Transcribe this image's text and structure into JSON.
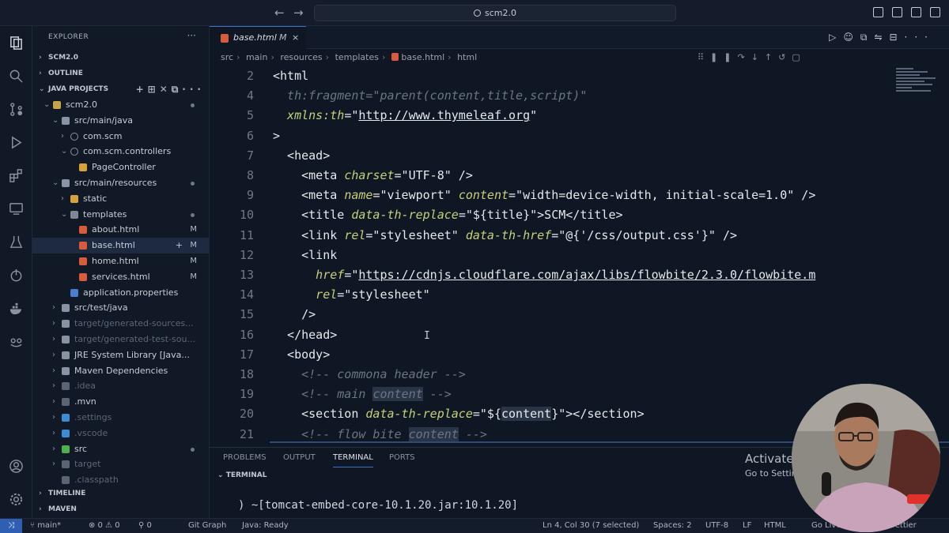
{
  "titlebar": {
    "search": "scm2.0",
    "back_icon": "arrow-left-icon",
    "forward_icon": "arrow-right-icon"
  },
  "explorer": {
    "title": "EXPLORER",
    "sections": {
      "scm": "SCM2.0",
      "outline": "OUTLINE",
      "java_projects": "JAVA PROJECTS",
      "timeline": "TIMELINE",
      "maven": "MAVEN"
    },
    "tree": [
      {
        "label": "scm2.0",
        "badge": "",
        "dot": true
      },
      {
        "label": "src/main/java",
        "badge": "",
        "dot": false
      },
      {
        "label": "com.scm",
        "badge": "",
        "dot": false
      },
      {
        "label": "com.scm.controllers",
        "badge": "",
        "dot": false
      },
      {
        "label": "PageController",
        "badge": "",
        "dot": false
      },
      {
        "label": "src/main/resources",
        "badge": "",
        "dot": true
      },
      {
        "label": "static",
        "badge": "",
        "dot": false
      },
      {
        "label": "templates",
        "badge": "",
        "dot": true
      },
      {
        "label": "about.html",
        "badge": "M",
        "dot": false
      },
      {
        "label": "base.html",
        "badge": "M",
        "dot": false
      },
      {
        "label": "home.html",
        "badge": "M",
        "dot": false
      },
      {
        "label": "services.html",
        "badge": "M",
        "dot": false
      },
      {
        "label": "application.properties",
        "badge": "",
        "dot": false
      },
      {
        "label": "src/test/java",
        "badge": "",
        "dot": false
      },
      {
        "label": "target/generated-sources...",
        "badge": "",
        "dot": false
      },
      {
        "label": "target/generated-test-sou...",
        "badge": "",
        "dot": false
      },
      {
        "label": "JRE System Library [Java...",
        "badge": "",
        "dot": false
      },
      {
        "label": "Maven Dependencies",
        "badge": "",
        "dot": false
      },
      {
        "label": ".idea",
        "badge": "",
        "dot": false
      },
      {
        "label": ".mvn",
        "badge": "",
        "dot": false
      },
      {
        "label": ".settings",
        "badge": "",
        "dot": false
      },
      {
        "label": ".vscode",
        "badge": "",
        "dot": false
      },
      {
        "label": "src",
        "badge": "",
        "dot": true
      },
      {
        "label": "target",
        "badge": "",
        "dot": false
      },
      {
        "label": ".classpath",
        "badge": "",
        "dot": false
      }
    ]
  },
  "editor": {
    "tab": {
      "label": "base.html",
      "modified": "M",
      "close": "×"
    },
    "breadcrumbs": [
      "src",
      "main",
      "resources",
      "templates",
      "base.html",
      "html"
    ],
    "lines": [
      {
        "n": "2",
        "tokens": [
          [
            "t-tag",
            "<html"
          ]
        ]
      },
      {
        "n": "4",
        "tokens": [
          [
            "t-cmt",
            "  th:fragment=\"parent(content,title,script)\""
          ]
        ]
      },
      {
        "n": "5",
        "tokens": [
          [
            "t-attr",
            "  xmlns:th"
          ],
          [
            "t-tag",
            "=\""
          ],
          [
            "t-url",
            "http://www.thymeleaf.org"
          ],
          [
            "t-tag",
            "\""
          ]
        ]
      },
      {
        "n": "6",
        "tokens": [
          [
            "t-tag",
            ">"
          ]
        ]
      },
      {
        "n": "7",
        "tokens": [
          [
            "t-tag",
            "  <head>"
          ]
        ]
      },
      {
        "n": "8",
        "tokens": [
          [
            "t-tag",
            "    <meta "
          ],
          [
            "t-attr",
            "charset"
          ],
          [
            "t-tag",
            "=\"UTF-8\" />"
          ]
        ]
      },
      {
        "n": "9",
        "tokens": [
          [
            "t-tag",
            "    <meta "
          ],
          [
            "t-attr",
            "name"
          ],
          [
            "t-tag",
            "=\"viewport\" "
          ],
          [
            "t-attr",
            "content"
          ],
          [
            "t-tag",
            "=\"width=device-width, initial-scale=1.0\" />"
          ]
        ]
      },
      {
        "n": "10",
        "tokens": [
          [
            "t-tag",
            "    <title "
          ],
          [
            "t-attr",
            "data-th-replace"
          ],
          [
            "t-tag",
            "=\"${title}\">SCM</title>"
          ]
        ]
      },
      {
        "n": "11",
        "tokens": [
          [
            "t-tag",
            "    <link "
          ],
          [
            "t-attr",
            "rel"
          ],
          [
            "t-tag",
            "=\"stylesheet\" "
          ],
          [
            "t-attr",
            "data-th-href"
          ],
          [
            "t-tag",
            "=\"@{'/css/output.css'}\" />"
          ]
        ]
      },
      {
        "n": "12",
        "tokens": [
          [
            "t-tag",
            "    <link"
          ]
        ]
      },
      {
        "n": "13",
        "tokens": [
          [
            "t-attr",
            "      href"
          ],
          [
            "t-tag",
            "=\""
          ],
          [
            "t-url",
            "https://cdnjs.cloudflare.com/ajax/libs/flowbite/2.3.0/flowbite.m"
          ]
        ]
      },
      {
        "n": "14",
        "tokens": [
          [
            "t-attr",
            "      rel"
          ],
          [
            "t-tag",
            "=\"stylesheet\""
          ]
        ]
      },
      {
        "n": "15",
        "tokens": [
          [
            "t-tag",
            "    />"
          ]
        ]
      },
      {
        "n": "16",
        "tokens": [
          [
            "t-tag",
            "  </head>"
          ]
        ]
      },
      {
        "n": "17",
        "tokens": [
          [
            "t-tag",
            "  <body>"
          ]
        ]
      },
      {
        "n": "18",
        "tokens": [
          [
            "t-cmt",
            "    <!-- commona header -->"
          ]
        ]
      },
      {
        "n": "19",
        "tokens": [
          [
            "t-cmt",
            "    <!-- main "
          ],
          [
            "t-cmt t-hl",
            "content"
          ],
          [
            "t-cmt",
            " -->"
          ]
        ]
      },
      {
        "n": "20",
        "tokens": [
          [
            "t-tag",
            "    <section "
          ],
          [
            "t-attr",
            "data-th-replace"
          ],
          [
            "t-tag",
            "=\"${"
          ],
          [
            "t-tag t-hl",
            "content"
          ],
          [
            "t-tag",
            "}\"></section>"
          ]
        ]
      },
      {
        "n": "21",
        "tokens": [
          [
            "t-cmt",
            "    <!-- flow bite "
          ],
          [
            "t-cmt t-hl",
            "content"
          ],
          [
            "t-cmt",
            " -->"
          ]
        ]
      },
      {
        "n": "22",
        "tokens": []
      }
    ]
  },
  "panel": {
    "tabs": [
      "PROBLEMS",
      "OUTPUT",
      "TERMINAL",
      "PORTS"
    ],
    "terminal_label": "TERMINAL",
    "terminal_line": ") ~[tomcat-embed-core-10.1.20.jar:10.1.20]"
  },
  "statusbar": {
    "branch": "main*",
    "problems": "⊗ 0 ⚠ 0",
    "ports": "⚲ 0",
    "git_graph": "Git Graph",
    "java": "Java: Ready",
    "position": "Ln 4, Col 30 (7 selected)",
    "spaces": "Spaces: 2",
    "encoding": "UTF-8",
    "eol": "LF",
    "language": "HTML",
    "go_live": "Go Live",
    "prettier": "Prettier"
  },
  "watermark": {
    "title": "Activate Windows",
    "subtitle": "Go to Settings to activate Windows."
  },
  "colors": {
    "accent": "#3b73c6",
    "background": "#0f1624",
    "html_icon": "#d85b3c"
  }
}
